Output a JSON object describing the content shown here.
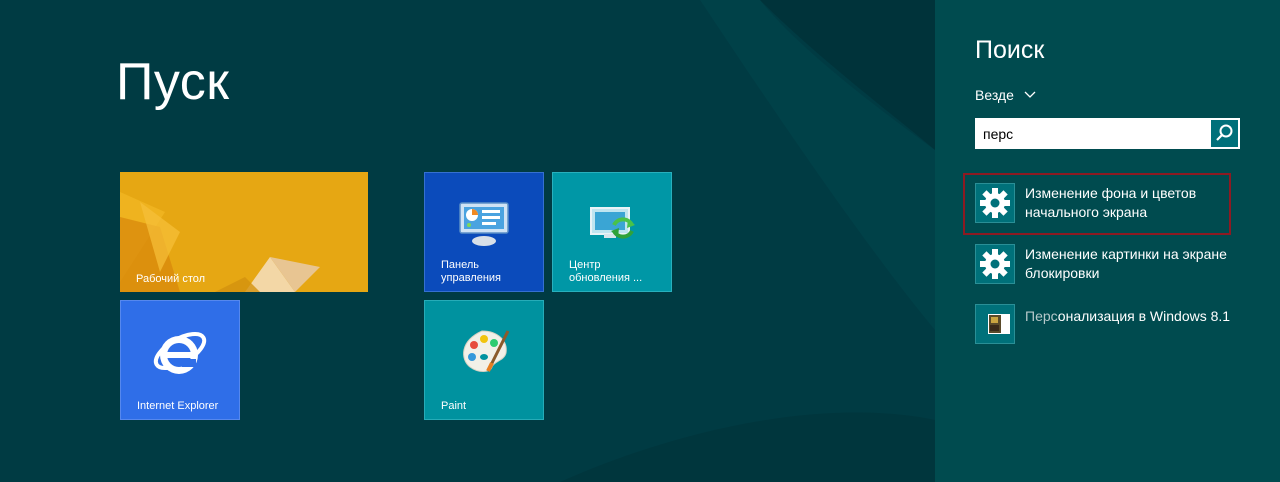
{
  "start": {
    "title": "Пуск",
    "tiles": [
      {
        "label": "Рабочий стол",
        "icon": "desktop-wallpaper"
      },
      {
        "label": "Панель\nуправления",
        "icon": "control-panel-icon"
      },
      {
        "label": "Центр\nобновления ...",
        "icon": "windows-update-icon"
      },
      {
        "label": "Internet Explorer",
        "icon": "internet-explorer-icon"
      },
      {
        "label": "Paint",
        "icon": "paint-palette-icon"
      }
    ]
  },
  "search": {
    "title": "Поиск",
    "scope": "Везде",
    "query": "перс",
    "results": [
      {
        "label": "Изменение фона и цветов начального экрана",
        "icon": "gear-icon",
        "highlighted": true
      },
      {
        "label": "Изменение картинки на экране блокировки",
        "icon": "gear-icon",
        "highlighted": false
      },
      {
        "match": "Перс",
        "rest": "онализация в Windows 8.1",
        "icon": "help-thumbnail-icon",
        "highlighted": false
      }
    ]
  },
  "colors": {
    "start_background": "#003b43",
    "search_pane_background": "#004b4f",
    "highlight_frame": "#8d1a22",
    "tile_desktop": "#e3a412",
    "tile_control_panel": "#0b4bbb",
    "tile_update": "#0097a6",
    "tile_ie": "#2f6ee8",
    "tile_paint": "#00929f"
  }
}
